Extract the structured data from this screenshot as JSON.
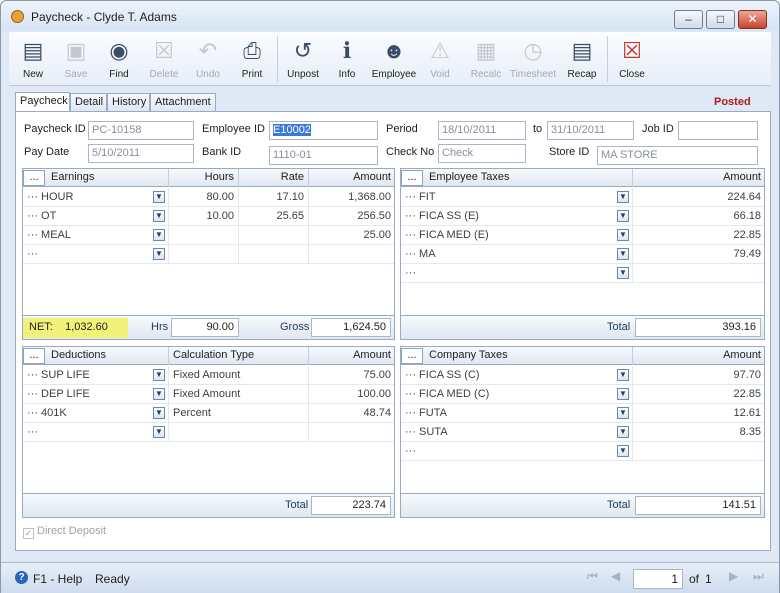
{
  "window": {
    "title": "Paycheck - Clyde T. Adams"
  },
  "toolbar": {
    "new": "New",
    "save": "Save",
    "find": "Find",
    "delete": "Delete",
    "undo": "Undo",
    "print": "Print",
    "unpost": "Unpost",
    "info": "Info",
    "employee": "Employee",
    "void": "Void",
    "recalc": "Recalc",
    "timesheet": "Timesheet",
    "recap": "Recap",
    "close": "Close"
  },
  "tabs": [
    "Paycheck",
    "Detail",
    "History",
    "Attachment"
  ],
  "status_label": "Posted",
  "form": {
    "paycheck_id_label": "Paycheck ID",
    "paycheck_id": "PC-10158",
    "employee_id_label": "Employee ID",
    "employee_id": "E10002",
    "period_label": "Period",
    "period_from": "18/10/2011",
    "to_label": "to",
    "period_to": "31/10/2011",
    "job_id_label": "Job ID",
    "job_id": "",
    "pay_date_label": "Pay Date",
    "pay_date": "5/10/2011",
    "bank_id_label": "Bank ID",
    "bank_id": "1110-01",
    "check_no_label": "Check No",
    "check_no": "Check",
    "store_id_label": "Store ID",
    "store_id": "MA STORE"
  },
  "earnings": {
    "headers": [
      "...",
      "Earnings",
      "Hours",
      "Rate",
      "Amount"
    ],
    "rows": [
      {
        "name": "HOUR",
        "hours": "80.00",
        "rate": "17.10",
        "amount": "1,368.00"
      },
      {
        "name": "OT",
        "hours": "10.00",
        "rate": "25.65",
        "amount": "256.50"
      },
      {
        "name": "MEAL",
        "hours": "",
        "rate": "",
        "amount": "25.00"
      },
      {
        "name": "",
        "hours": "",
        "rate": "",
        "amount": ""
      }
    ],
    "net_label": "NET:",
    "net": "1,032.60",
    "hrs_label": "Hrs",
    "hrs": "90.00",
    "gross_label": "Gross",
    "gross": "1,624.50"
  },
  "employee_taxes": {
    "headers": [
      "...",
      "Employee Taxes",
      "Amount"
    ],
    "rows": [
      {
        "name": "FIT",
        "amount": "224.64"
      },
      {
        "name": "FICA SS (E)",
        "amount": "66.18"
      },
      {
        "name": "FICA MED (E)",
        "amount": "22.85"
      },
      {
        "name": "MA",
        "amount": "79.49"
      },
      {
        "name": "",
        "amount": ""
      }
    ],
    "total_label": "Total",
    "total": "393.16"
  },
  "deductions": {
    "headers": [
      "...",
      "Deductions",
      "Calculation Type",
      "Amount"
    ],
    "rows": [
      {
        "name": "SUP LIFE",
        "calc": "Fixed Amount",
        "amount": "75.00"
      },
      {
        "name": "DEP LIFE",
        "calc": "Fixed Amount",
        "amount": "100.00"
      },
      {
        "name": "401K",
        "calc": "Percent",
        "amount": "48.74"
      },
      {
        "name": "",
        "calc": "",
        "amount": ""
      }
    ],
    "total_label": "Total",
    "total": "223.74"
  },
  "company_taxes": {
    "headers": [
      "...",
      "Company Taxes",
      "Amount"
    ],
    "rows": [
      {
        "name": "FICA SS (C)",
        "amount": "97.70"
      },
      {
        "name": "FICA MED (C)",
        "amount": "22.85"
      },
      {
        "name": "FUTA",
        "amount": "12.61"
      },
      {
        "name": "SUTA",
        "amount": "8.35"
      },
      {
        "name": "",
        "amount": ""
      }
    ],
    "total_label": "Total",
    "total": "141.51"
  },
  "direct_deposit_label": "Direct Deposit",
  "statusbar": {
    "help": "F1 - Help",
    "state": "Ready",
    "page": "1",
    "of_label": "of",
    "page_count": "1"
  },
  "colors": {
    "accent": "#b01b1b",
    "net_highlight": "#f2f27a",
    "selection": "#3a79d4"
  }
}
